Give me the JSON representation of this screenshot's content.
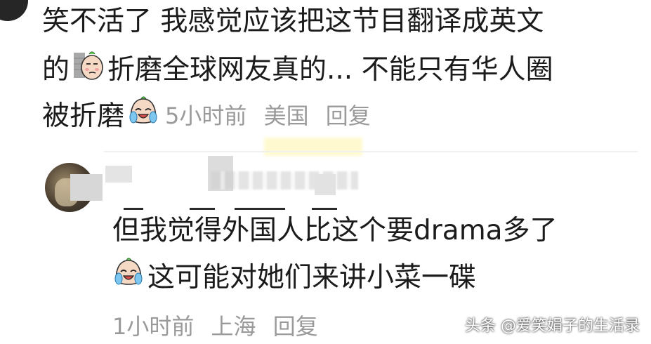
{
  "comment_1": {
    "line_1": "笑不活了 我感觉应该把这节目翻译成英文",
    "line_2_start": "的",
    "line_2_end": "折磨全球网友真的... 不能只有华人圈",
    "line_3": "被折磨",
    "time": "5小时前",
    "location": "美国",
    "reply": "回复"
  },
  "comment_2": {
    "line_1": "但我觉得外国人比这个要drama多了",
    "line_2": "这可能对她们来讲小菜一碟",
    "time": "1小时前",
    "location": "上海",
    "reply": "回复"
  },
  "emojis": {
    "smirk": "smirk-emoji-icon",
    "cry": "laugh-cry-emoji-icon"
  },
  "watermark": "头条 @爱笑娟子的生活录",
  "colors": {
    "text": "#1b1b1b",
    "meta": "#9a9a9a",
    "highlight": "#ffee6e"
  }
}
